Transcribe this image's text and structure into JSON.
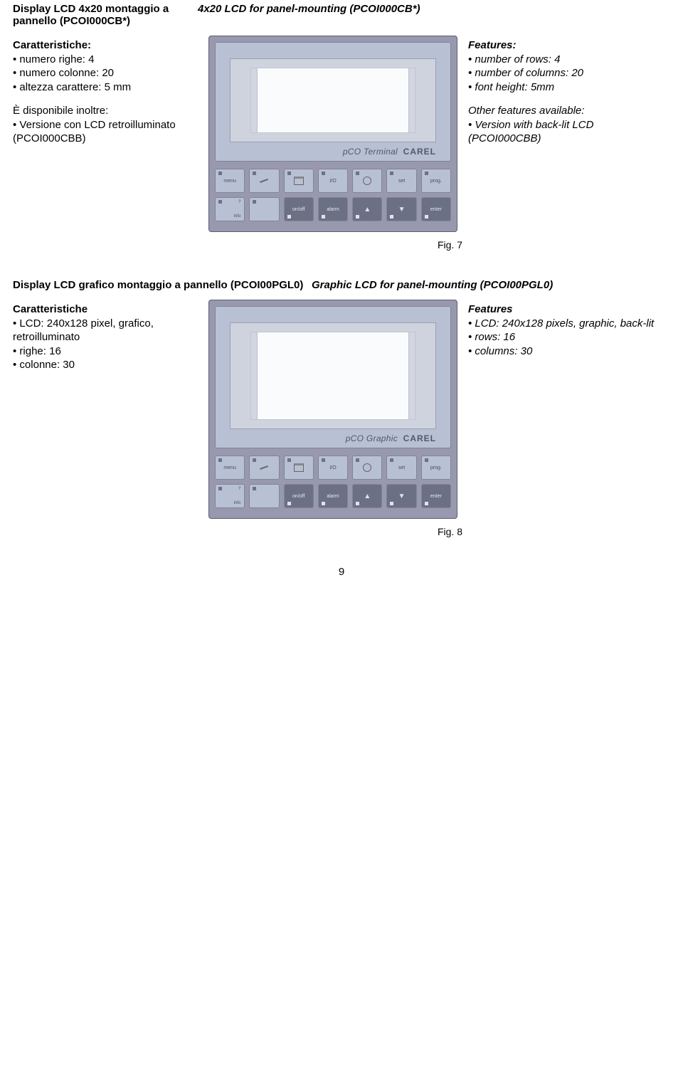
{
  "section1": {
    "title_it": "Display LCD 4x20 montaggio a pannello (PCOI000CB*)",
    "title_en": "4x20 LCD for panel-mounting (PCOI000CB*)",
    "specs_it_heading": "Caratteristiche:",
    "specs_it": [
      "numero righe: 4",
      "numero colonne: 20",
      "altezza carattere: 5 mm"
    ],
    "avail_it_heading": "È disponibile inoltre:",
    "avail_it": [
      "Versione con LCD retroilluminato (PCOI000CBB)"
    ],
    "specs_en_heading": "Features:",
    "specs_en": [
      "number of rows: 4",
      "number of columns: 20",
      "font height: 5mm"
    ],
    "avail_en_heading": "Other features available:",
    "avail_en": [
      "Version with back-lit LCD (PCOI000CBB)"
    ],
    "device_name": "pCO Terminal",
    "brand": "CAREL",
    "figure": "Fig. 7"
  },
  "section2": {
    "title_it": "Display LCD grafico montaggio a pannello (PCOI00PGL0)",
    "title_en": "Graphic LCD for panel-mounting (PCOI00PGL0)",
    "specs_it_heading": "Caratteristiche",
    "specs_it": [
      "LCD: 240x128 pixel, grafico, retroilluminato",
      "righe: 16",
      "colonne: 30"
    ],
    "specs_en_heading": "Features",
    "specs_en": [
      "LCD: 240x128 pixels, graphic, back-lit",
      "rows: 16",
      "columns: 30"
    ],
    "device_name": "pCO Graphic",
    "brand": "CAREL",
    "figure": "Fig. 8"
  },
  "keypad": {
    "row1": [
      "menu",
      "",
      "",
      "I/O",
      "",
      "set",
      "prog."
    ],
    "row1_icons": [
      "",
      "tool",
      "printer",
      "",
      "clock",
      "",
      ""
    ],
    "row2_left": {
      "top": "?",
      "bot": "info"
    },
    "row2_labels": [
      "",
      "on/off",
      "alarm",
      "",
      "",
      "enter"
    ]
  },
  "page_number": "9"
}
